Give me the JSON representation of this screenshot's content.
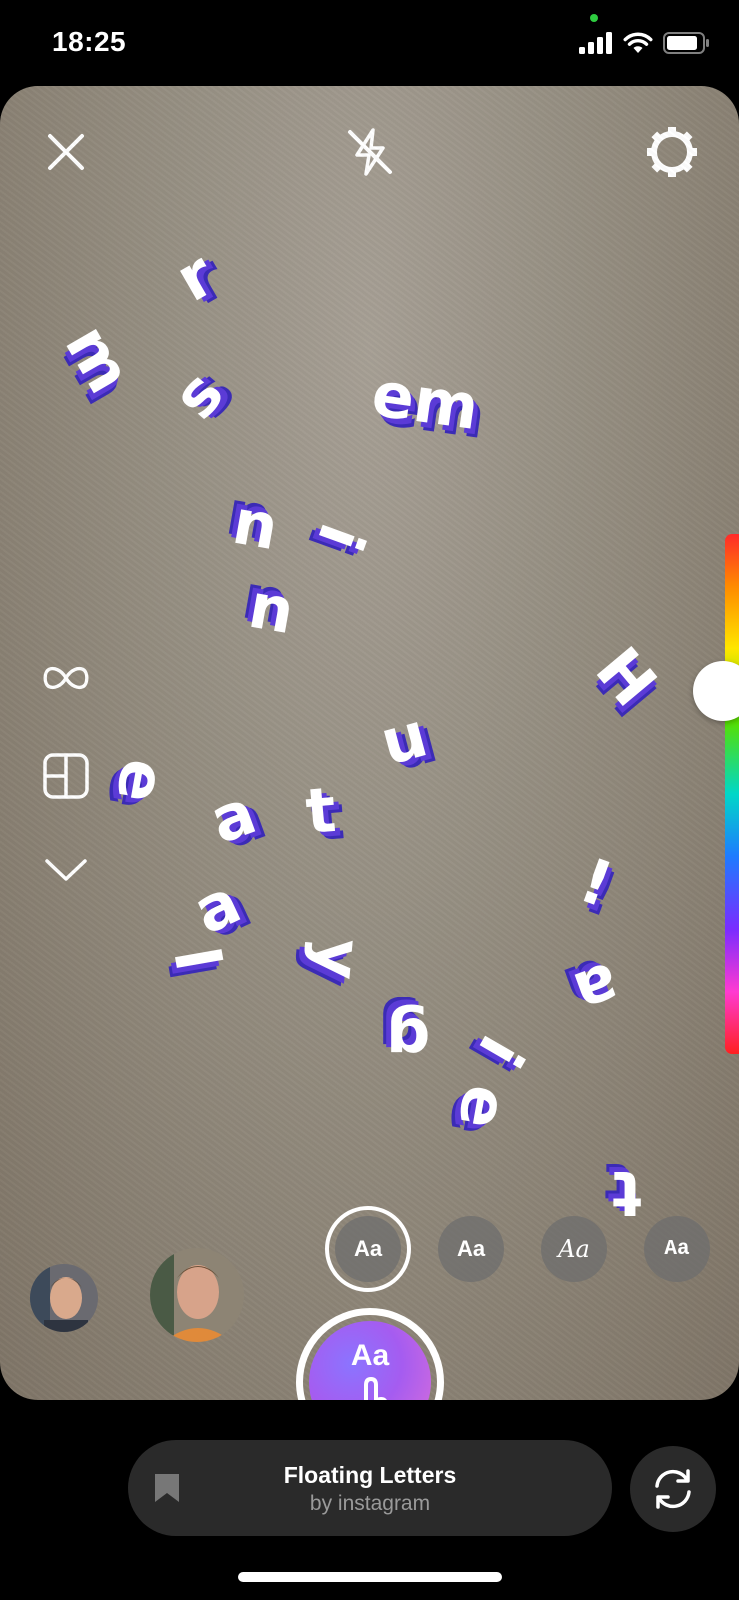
{
  "status_bar": {
    "time": "18:25"
  },
  "camera": {
    "floating_letters": [
      "r",
      "m",
      "s",
      "em",
      "u",
      "i",
      "u",
      "H",
      "u",
      "e",
      "a",
      "t",
      "!",
      "a",
      "l",
      "y",
      "a",
      "g",
      "i",
      "e",
      "t"
    ]
  },
  "font_options": [
    "Aa",
    "Aa",
    "Aa",
    "Aa"
  ],
  "capture": {
    "label": "Aa"
  },
  "effect": {
    "name": "Floating Letters",
    "author": "by instagram"
  },
  "icons": {
    "close": "close-icon",
    "flash": "flash-off-icon",
    "settings": "gear-icon",
    "boomerang": "infinity-icon",
    "layout": "layout-icon",
    "more": "chevron-down-icon",
    "save_effect": "bookmark-icon",
    "flip_camera": "flip-camera-icon"
  },
  "colors": {
    "letter_shadow": "#5b3bd6",
    "capture_gradient_start": "#8b74ff",
    "capture_gradient_end": "#e070d8"
  }
}
